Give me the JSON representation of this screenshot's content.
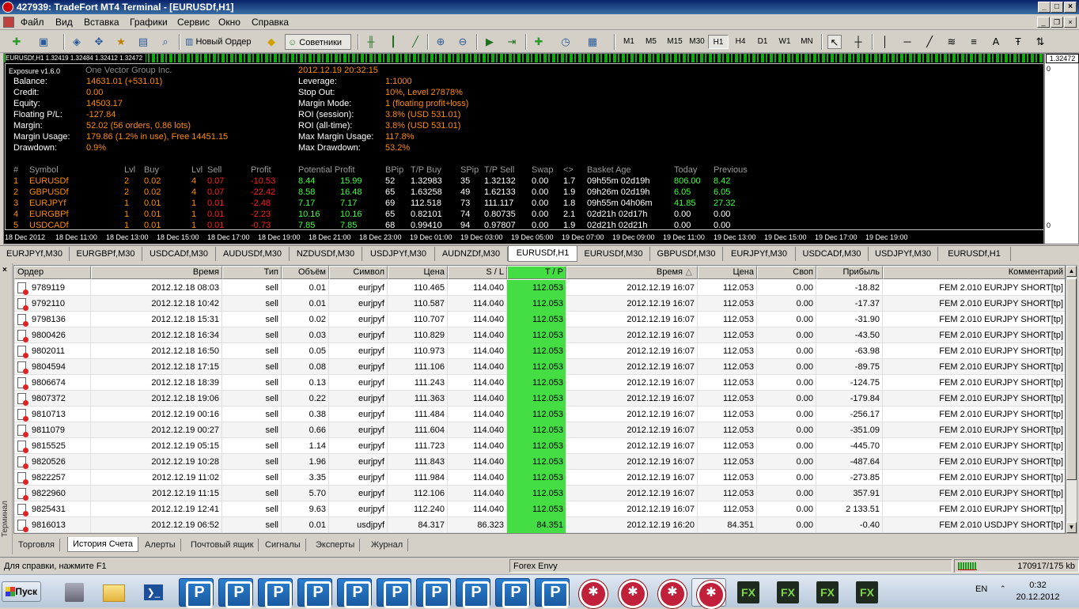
{
  "window": {
    "title": "427939: TradeFort MT4 Terminal - [EURUSDf,H1]"
  },
  "menu": {
    "items": [
      "Файл",
      "Вид",
      "Вставка",
      "Графики",
      "Сервис",
      "Окно",
      "Справка"
    ]
  },
  "toolbar": {
    "new_order_label": "Новый Ордер",
    "experts_label": "Советники",
    "periods": [
      "M1",
      "M5",
      "M15",
      "M30",
      "H1",
      "H4",
      "D1",
      "W1",
      "MN"
    ],
    "selected_period": "H1"
  },
  "chart": {
    "ticker_text": "EURUSDf,H1  1.32419 1.32484 1.32412 1.32472",
    "price_box": "1.32472",
    "zero_top": "0",
    "zero_bottom": "0",
    "time_axis": [
      "18 Dec 2012",
      "18 Dec 11:00",
      "18 Dec 13:00",
      "18 Dec 15:00",
      "18 Dec 17:00",
      "18 Dec 19:00",
      "18 Dec 21:00",
      "18 Dec 23:00",
      "19 Dec 01:00",
      "19 Dec 03:00",
      "19 Dec 05:00",
      "19 Dec 07:00",
      "19 Dec 09:00",
      "19 Dec 11:00",
      "19 Dec 13:00",
      "19 Dec 15:00",
      "19 Dec 17:00",
      "19 Dec 19:00"
    ]
  },
  "exposure": {
    "title": "Exposure v1.6.0",
    "company": "One Vector Group Inc.",
    "datetime": "2012.12.19 20:32:15",
    "left": [
      {
        "label": "Balance:",
        "value": "14631.01 (+531.01)"
      },
      {
        "label": "Credit:",
        "value": "0.00"
      },
      {
        "label": "Equity:",
        "value": "14503.17"
      },
      {
        "label": "Floating P/L:",
        "value": "-127.84"
      },
      {
        "label": "Margin:",
        "value": "52.02 (56 orders, 0.86 lots)"
      },
      {
        "label": "Margin Usage:",
        "value": "179.86 (1.2% in use), Free 14451.15"
      },
      {
        "label": "Drawdown:",
        "value": "0.9%"
      }
    ],
    "right": [
      {
        "label": "Leverage:",
        "value": "1:1000"
      },
      {
        "label": "Stop Out:",
        "value": "10%, Level 27878%"
      },
      {
        "label": "Margin Mode:",
        "value": "1 (floating profit+loss)"
      },
      {
        "label": "ROI (session):",
        "value": "3.8% (USD 531.01)"
      },
      {
        "label": "ROI (all-time):",
        "value": "3.8% (USD 531.01)"
      },
      {
        "label": "Max Margin Usage:",
        "value": "117.8%"
      },
      {
        "label": "Max Drawdown:",
        "value": "53.2%"
      }
    ],
    "headers": [
      "#",
      "Symbol",
      "Lvl",
      "Buy",
      "Lvl",
      "Sell",
      "Profit",
      "Potential Profit",
      "BPip",
      "T/P Buy",
      "SPip",
      "T/P Sell",
      "Swap",
      "<>",
      "Basket Age",
      "Today",
      "Previous"
    ],
    "rows": [
      [
        "1",
        "EURUSDf",
        "2",
        "0.02",
        "4",
        "0.07",
        "-10.53",
        "8.44",
        "15.99",
        "52",
        "1.32983",
        "35",
        "1.32132",
        "0.00",
        "1.7",
        "09h55m 02d19h",
        "806.00",
        "8.42"
      ],
      [
        "2",
        "GBPUSDf",
        "2",
        "0.02",
        "4",
        "0.07",
        "-22.42",
        "8.58",
        "16.48",
        "65",
        "1.63258",
        "49",
        "1.62133",
        "0.00",
        "1.9",
        "09h26m 02d19h",
        "6.05",
        "6.05"
      ],
      [
        "3",
        "EURJPYf",
        "1",
        "0.01",
        "1",
        "0.01",
        "-2.48",
        "7.17",
        "7.17",
        "69",
        "112.518",
        "73",
        "111.117",
        "0.00",
        "1.8",
        "09h55m 04h06m",
        "41.85",
        "27.32"
      ],
      [
        "4",
        "EURGBPf",
        "1",
        "0.01",
        "1",
        "0.01",
        "-2.23",
        "10.16",
        "10.16",
        "65",
        "0.82101",
        "74",
        "0.80735",
        "0.00",
        "2.1",
        "02d21h 02d17h",
        "0.00",
        "0.00"
      ],
      [
        "5",
        "USDCADf",
        "1",
        "0.01",
        "1",
        "0.01",
        "-0.73",
        "7.85",
        "7.85",
        "68",
        "0.99410",
        "94",
        "0.97807",
        "0.00",
        "1.9",
        "02d21h 02d21h",
        "0.00",
        "0.00"
      ]
    ]
  },
  "chart_tabs": [
    "EURJPYf,M30",
    "EURGBPf,M30",
    "USDCADf,M30",
    "AUDUSDf,M30",
    "NZDUSDf,M30",
    "USDJPYf,M30",
    "AUDNZDf,M30",
    "EURUSDf,H1",
    "EURUSDf,M30",
    "GBPUSDf,M30",
    "EURJPYf,M30",
    "USDCADf,M30",
    "USDJPYf,M30",
    "EURUSDf,H1"
  ],
  "selected_chart_tab": 7,
  "terminal": {
    "close": "×",
    "side_label": "Терминал",
    "columns": [
      "Ордер",
      "Время",
      "Тип",
      "Объём",
      "Символ",
      "Цена",
      "S / L",
      "T / P",
      "Время",
      "Цена",
      "Своп",
      "Прибыль",
      "Комментарий"
    ],
    "sort_indicator": "△",
    "rows": [
      [
        "9789119",
        "2012.12.18 08:03",
        "sell",
        "0.01",
        "eurjpyf",
        "110.465",
        "114.040",
        "112.053",
        "2012.12.19 16:07",
        "112.053",
        "0.00",
        "-18.82",
        "FEM 2.010 EURJPY SHORT[tp]"
      ],
      [
        "9792110",
        "2012.12.18 10:42",
        "sell",
        "0.01",
        "eurjpyf",
        "110.587",
        "114.040",
        "112.053",
        "2012.12.19 16:07",
        "112.053",
        "0.00",
        "-17.37",
        "FEM 2.010 EURJPY SHORT[tp]"
      ],
      [
        "9798136",
        "2012.12.18 15:31",
        "sell",
        "0.02",
        "eurjpyf",
        "110.707",
        "114.040",
        "112.053",
        "2012.12.19 16:07",
        "112.053",
        "0.00",
        "-31.90",
        "FEM 2.010 EURJPY SHORT[tp]"
      ],
      [
        "9800426",
        "2012.12.18 16:34",
        "sell",
        "0.03",
        "eurjpyf",
        "110.829",
        "114.040",
        "112.053",
        "2012.12.19 16:07",
        "112.053",
        "0.00",
        "-43.50",
        "FEM 2.010 EURJPY SHORT[tp]"
      ],
      [
        "9802011",
        "2012.12.18 16:50",
        "sell",
        "0.05",
        "eurjpyf",
        "110.973",
        "114.040",
        "112.053",
        "2012.12.19 16:07",
        "112.053",
        "0.00",
        "-63.98",
        "FEM 2.010 EURJPY SHORT[tp]"
      ],
      [
        "9804594",
        "2012.12.18 17:15",
        "sell",
        "0.08",
        "eurjpyf",
        "111.106",
        "114.040",
        "112.053",
        "2012.12.19 16:07",
        "112.053",
        "0.00",
        "-89.75",
        "FEM 2.010 EURJPY SHORT[tp]"
      ],
      [
        "9806674",
        "2012.12.18 18:39",
        "sell",
        "0.13",
        "eurjpyf",
        "111.243",
        "114.040",
        "112.053",
        "2012.12.19 16:07",
        "112.053",
        "0.00",
        "-124.75",
        "FEM 2.010 EURJPY SHORT[tp]"
      ],
      [
        "9807372",
        "2012.12.18 19:06",
        "sell",
        "0.22",
        "eurjpyf",
        "111.363",
        "114.040",
        "112.053",
        "2012.12.19 16:07",
        "112.053",
        "0.00",
        "-179.84",
        "FEM 2.010 EURJPY SHORT[tp]"
      ],
      [
        "9810713",
        "2012.12.19 00:16",
        "sell",
        "0.38",
        "eurjpyf",
        "111.484",
        "114.040",
        "112.053",
        "2012.12.19 16:07",
        "112.053",
        "0.00",
        "-256.17",
        "FEM 2.010 EURJPY SHORT[tp]"
      ],
      [
        "9811079",
        "2012.12.19 00:27",
        "sell",
        "0.66",
        "eurjpyf",
        "111.604",
        "114.040",
        "112.053",
        "2012.12.19 16:07",
        "112.053",
        "0.00",
        "-351.09",
        "FEM 2.010 EURJPY SHORT[tp]"
      ],
      [
        "9815525",
        "2012.12.19 05:15",
        "sell",
        "1.14",
        "eurjpyf",
        "111.723",
        "114.040",
        "112.053",
        "2012.12.19 16:07",
        "112.053",
        "0.00",
        "-445.70",
        "FEM 2.010 EURJPY SHORT[tp]"
      ],
      [
        "9820526",
        "2012.12.19 10:28",
        "sell",
        "1.96",
        "eurjpyf",
        "111.843",
        "114.040",
        "112.053",
        "2012.12.19 16:07",
        "112.053",
        "0.00",
        "-487.64",
        "FEM 2.010 EURJPY SHORT[tp]"
      ],
      [
        "9822257",
        "2012.12.19 11:02",
        "sell",
        "3.35",
        "eurjpyf",
        "111.984",
        "114.040",
        "112.053",
        "2012.12.19 16:07",
        "112.053",
        "0.00",
        "-273.85",
        "FEM 2.010 EURJPY SHORT[tp]"
      ],
      [
        "9822960",
        "2012.12.19 11:15",
        "sell",
        "5.70",
        "eurjpyf",
        "112.106",
        "114.040",
        "112.053",
        "2012.12.19 16:07",
        "112.053",
        "0.00",
        "357.91",
        "FEM 2.010 EURJPY SHORT[tp]"
      ],
      [
        "9825431",
        "2012.12.19 12:41",
        "sell",
        "9.63",
        "eurjpyf",
        "112.240",
        "114.040",
        "112.053",
        "2012.12.19 16:07",
        "112.053",
        "0.00",
        "2 133.51",
        "FEM 2.010 EURJPY SHORT[tp]"
      ],
      [
        "9816013",
        "2012.12.19 06:52",
        "sell",
        "0.01",
        "usdjpyf",
        "84.317",
        "86.323",
        "84.351",
        "2012.12.19 16:20",
        "84.351",
        "0.00",
        "-0.40",
        "FEM 2.010 USDJPY SHORT[tp]"
      ]
    ],
    "tabs": [
      "Торговля",
      "История Счета",
      "Алерты",
      "Почтовый ящик",
      "Сигналы",
      "Эксперты",
      "Журнал"
    ],
    "selected_tab": 1
  },
  "statusbar": {
    "help": "Для справки, нажмите F1",
    "profile": "Forex Envy",
    "traffic": "170917/175 kb"
  },
  "taskbar": {
    "start": "Пуск",
    "lang": "EN",
    "time": "0:32",
    "date": "20.12.2012"
  },
  "colors": {
    "tp_highlight": "#44dd44",
    "label_white": "#ffffff",
    "value_orange": "#ff8c00",
    "value_red": "#ff2020",
    "value_green": "#40ff40"
  }
}
